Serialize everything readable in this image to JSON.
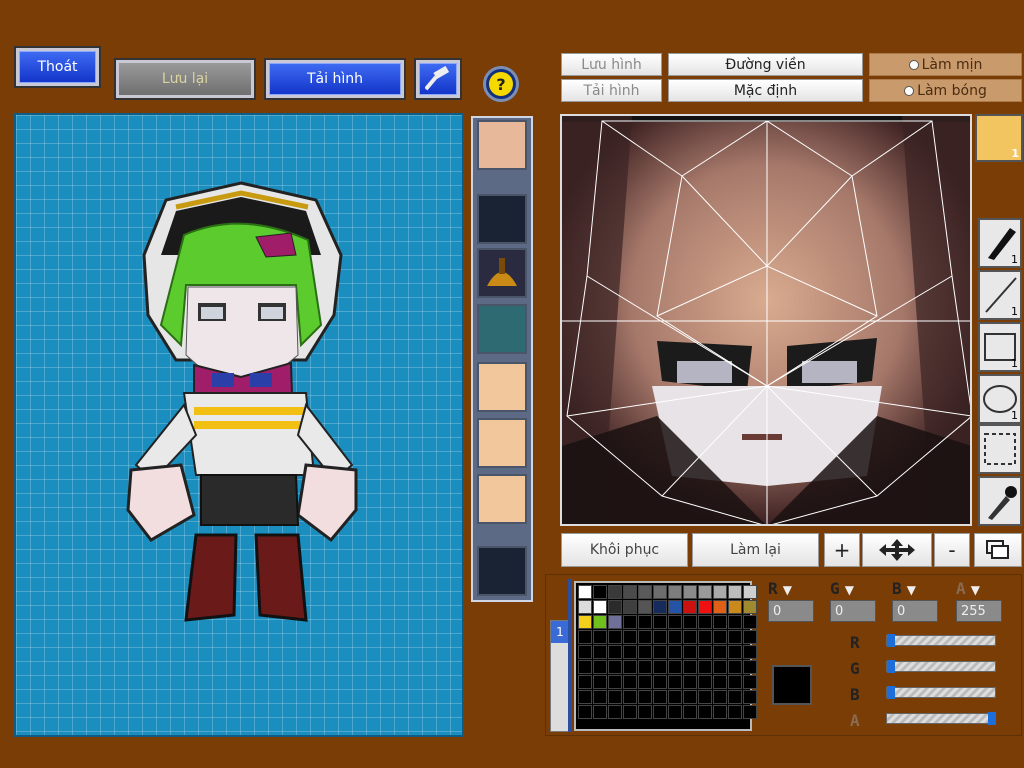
{
  "toolbar": {
    "exit_label": "Thoát",
    "save_label": "Lưu lại",
    "load_label": "Tải hình",
    "help_symbol": "?"
  },
  "editor_top": {
    "save_image": "Lưu hình",
    "load_image": "Tải hình",
    "outline": "Đường viền",
    "default": "Mặc định",
    "smooth": "Làm mịn",
    "shade": "Làm bóng"
  },
  "tool_badges": {
    "face_count": "1",
    "pen": "1",
    "line": "1",
    "rect": "1",
    "ellipse": "1"
  },
  "actions": {
    "restore": "Khôi phục",
    "redo": "Làm lại",
    "plus": "+",
    "minus": "-"
  },
  "color": {
    "channels": [
      "R",
      "G",
      "B",
      "A"
    ],
    "values": [
      "0",
      "0",
      "0",
      "255"
    ],
    "current": "#000000",
    "palette_tab": "1",
    "palette": [
      "#ffffff",
      "#000000",
      "#3a3a3a",
      "#4b4b4b",
      "#5a5a5a",
      "#6d6d6d",
      "#7d7d7d",
      "#8a8a8a",
      "#9a9a9a",
      "#aaaaaa",
      "#bcbcbc",
      "#cfcfcf",
      "#dcdcdc",
      "#ffffff",
      "#2b2b2b",
      "#3f3f3f",
      "#555555",
      "#142b5c",
      "#2553a6",
      "#cc1111",
      "#ee1111",
      "#e06018",
      "#c9891b",
      "#9f8a30",
      "#f2cf1a",
      "#6fbf1d",
      "#6f6f9a"
    ],
    "slider_levels": [
      0,
      0,
      0,
      1
    ]
  },
  "icons": {
    "hammer": "hammer-icon",
    "help": "help-icon",
    "pen": "pen-icon",
    "line": "line-icon",
    "rect": "rect-icon",
    "ellipse": "ellipse-icon",
    "select": "select-icon",
    "eyedropper": "eyedropper-icon",
    "move": "move-icon",
    "layers": "layers-icon"
  }
}
